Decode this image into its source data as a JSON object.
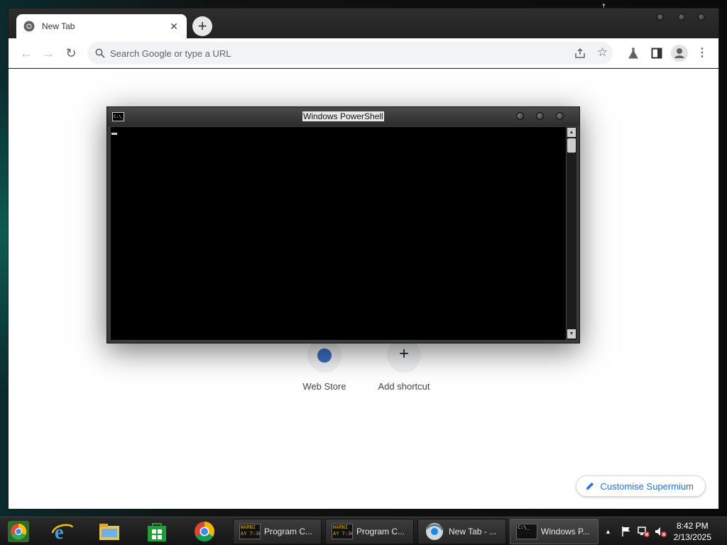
{
  "browser": {
    "tab_title": "New Tab",
    "close_glyph": "✕",
    "new_tab_glyph": "+",
    "omnibox_placeholder": "Search Google or type a URL",
    "shortcuts": [
      {
        "label": "Web Store"
      },
      {
        "label": "Add shortcut"
      }
    ],
    "customise_label": "Customise Supermium"
  },
  "powershell": {
    "title": "Windows PowerShell",
    "icon_text": "C:\\_"
  },
  "taskbar": {
    "pinned": [
      "chrome-icon",
      "internet-explorer-icon",
      "file-explorer-icon",
      "store-icon",
      "chrome-icon"
    ],
    "buttons": [
      {
        "label": "Program C...",
        "thumb": "WARNI\nAY 7:36"
      },
      {
        "label": "Program C...",
        "thumb": "WARNI\nAY 7:36"
      },
      {
        "label": "New Tab - ...",
        "thumb": ""
      },
      {
        "label": "Windows P...",
        "thumb": "C:\\_"
      }
    ],
    "tray_chevron": "▲",
    "time": "8:42 PM",
    "date": "2/13/2025"
  },
  "colors": {
    "accent": "#1a73e8",
    "console_bg": "#000000"
  }
}
